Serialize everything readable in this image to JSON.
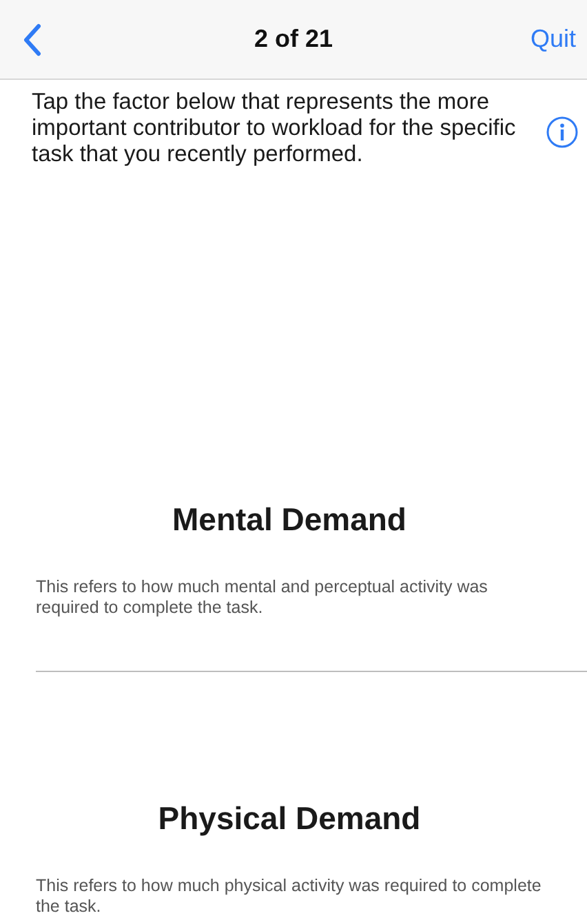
{
  "nav_bar": {
    "title": "2 of 21",
    "quit": "Quit"
  },
  "instruction": "Tap the factor below that represents the more important contributor to workload for the specific task that you recently performed.",
  "factors": [
    {
      "title": "Mental Demand",
      "description": "This refers to how much mental and perceptual activity was required to complete the task."
    },
    {
      "title": "Physical Demand",
      "description": "This refers to how much physical activity was required to complete the task."
    }
  ]
}
